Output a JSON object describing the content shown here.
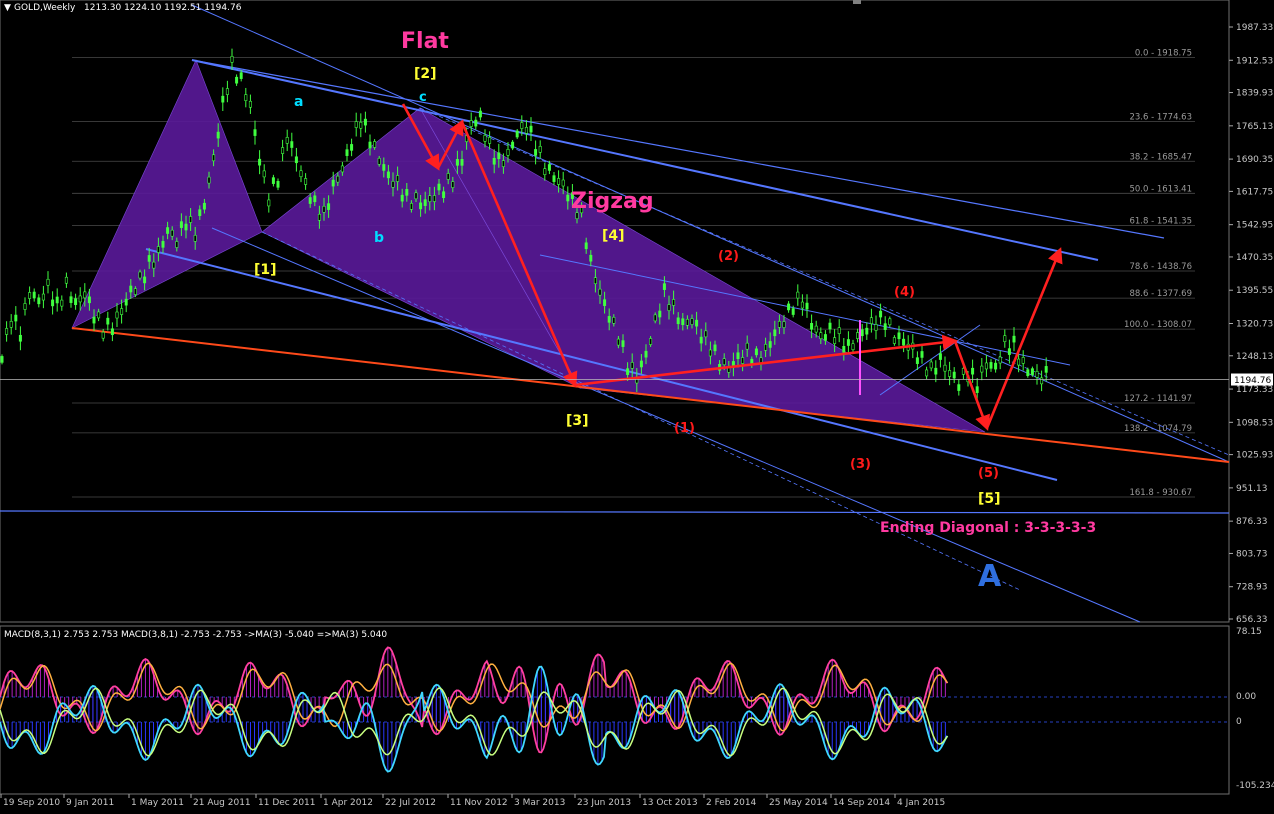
{
  "header": {
    "symbol": "GOLD,Weekly",
    "ohlc": "1213.30 1224.10 1192.51 1194.76"
  },
  "macd": {
    "label": "MACD(8,3,1) 2.753 2.753  MACD(3,8,1) -2.753 -2.753  ->MA(3) -5.040  =>MA(3) 5.040",
    "ticks": [
      "78.15",
      "0.00",
      "0",
      "-105.234"
    ]
  },
  "colors": {
    "bg": "#000000",
    "candle": "#40ff40",
    "triangle": "#5a1a9a",
    "channel": "#5577ff",
    "orange": "#ff4a1a",
    "red": "#ff1a1a",
    "cyan": "#00ddff",
    "yellow": "#ffff33",
    "magenta": "#ff3aa0",
    "wave": "#ff2020",
    "blueA": "#2f6fdf"
  },
  "chart_data": {
    "type": "line",
    "title": "GOLD,Weekly",
    "y_price_ticks": [
      "1987.33",
      "1912.53",
      "1839.93",
      "1765.13",
      "1690.35",
      "1617.75",
      "1542.95",
      "1470.35",
      "1395.55",
      "1320.73",
      "1248.13",
      "1173.33",
      "1098.53",
      "1025.93",
      "951.13",
      "876.33",
      "803.73",
      "728.93",
      "656.33"
    ],
    "ylim": [
      640,
      2010
    ],
    "current_price": "1194.76",
    "x_ticks": [
      "19 Sep 2010",
      "9 Jan 2011",
      "1 May 2011",
      "21 Aug 2011",
      "11 Dec 2011",
      "1 Apr 2012",
      "22 Jul 2012",
      "11 Nov 2012",
      "3 Mar 2013",
      "23 Jun 2013",
      "13 Oct 2013",
      "2 Feb 2014",
      "25 May 2014",
      "14 Sep 2014",
      "4 Jan 2015"
    ],
    "fib_levels": [
      {
        "label": "0.0 - 1918.75",
        "price": 1918.75
      },
      {
        "label": "23.6 - 1774.63",
        "price": 1774.63
      },
      {
        "label": "38.2 - 1685.47",
        "price": 1685.47
      },
      {
        "label": "50.0 - 1613.41",
        "price": 1613.41
      },
      {
        "label": "61.8 - 1541.35",
        "price": 1541.35
      },
      {
        "label": "78.6 - 1438.76",
        "price": 1438.76
      },
      {
        "label": "88.6 - 1377.69",
        "price": 1377.69
      },
      {
        "label": "100.0 - 1308.07",
        "price": 1308.07
      },
      {
        "label": "127.2 - 1141.97",
        "price": 1141.97
      },
      {
        "label": "138.2 - 1074.79",
        "price": 1074.79
      },
      {
        "label": "161.8 - 930.67",
        "price": 930.67
      }
    ],
    "price_path": [
      [
        0,
        1240
      ],
      [
        4,
        1330
      ],
      [
        8,
        1305
      ],
      [
        12,
        1400
      ],
      [
        16,
        1380
      ],
      [
        20,
        1410
      ],
      [
        24,
        1360
      ],
      [
        28,
        1400
      ],
      [
        32,
        1355
      ],
      [
        36,
        1380
      ],
      [
        40,
        1335
      ],
      [
        44,
        1310
      ],
      [
        48,
        1320
      ],
      [
        52,
        1360
      ],
      [
        56,
        1400
      ],
      [
        60,
        1420
      ],
      [
        64,
        1450
      ],
      [
        68,
        1470
      ],
      [
        72,
        1520
      ],
      [
        76,
        1500
      ],
      [
        80,
        1550
      ],
      [
        84,
        1530
      ],
      [
        88,
        1600
      ],
      [
        92,
        1700
      ],
      [
        96,
        1820
      ],
      [
        100,
        1900
      ],
      [
        104,
        1860
      ],
      [
        108,
        1800
      ],
      [
        112,
        1680
      ],
      [
        116,
        1600
      ],
      [
        120,
        1650
      ],
      [
        124,
        1750
      ],
      [
        128,
        1700
      ],
      [
        132,
        1640
      ],
      [
        136,
        1590
      ],
      [
        140,
        1560
      ],
      [
        144,
        1620
      ],
      [
        148,
        1660
      ],
      [
        152,
        1720
      ],
      [
        156,
        1780
      ],
      [
        160,
        1740
      ],
      [
        164,
        1700
      ],
      [
        168,
        1660
      ],
      [
        172,
        1640
      ],
      [
        176,
        1600
      ],
      [
        180,
        1590
      ],
      [
        184,
        1580
      ],
      [
        188,
        1600
      ],
      [
        192,
        1620
      ],
      [
        196,
        1650
      ],
      [
        200,
        1700
      ],
      [
        204,
        1780
      ],
      [
        208,
        1790
      ],
      [
        212,
        1720
      ],
      [
        216,
        1680
      ],
      [
        220,
        1690
      ],
      [
        224,
        1740
      ],
      [
        228,
        1760
      ],
      [
        232,
        1720
      ],
      [
        236,
        1680
      ],
      [
        240,
        1660
      ],
      [
        244,
        1640
      ],
      [
        248,
        1600
      ],
      [
        252,
        1560
      ],
      [
        256,
        1450
      ],
      [
        260,
        1380
      ],
      [
        264,
        1330
      ],
      [
        268,
        1290
      ],
      [
        272,
        1230
      ],
      [
        276,
        1210
      ],
      [
        280,
        1260
      ],
      [
        284,
        1330
      ],
      [
        288,
        1390
      ],
      [
        292,
        1350
      ],
      [
        296,
        1310
      ],
      [
        300,
        1320
      ],
      [
        304,
        1290
      ],
      [
        308,
        1270
      ],
      [
        312,
        1240
      ],
      [
        316,
        1230
      ],
      [
        320,
        1250
      ],
      [
        324,
        1260
      ],
      [
        328,
        1240
      ],
      [
        332,
        1250
      ],
      [
        336,
        1290
      ],
      [
        340,
        1320
      ],
      [
        344,
        1360
      ],
      [
        348,
        1380
      ],
      [
        352,
        1330
      ],
      [
        356,
        1300
      ],
      [
        360,
        1310
      ],
      [
        364,
        1290
      ],
      [
        368,
        1260
      ],
      [
        372,
        1280
      ],
      [
        376,
        1300
      ],
      [
        380,
        1320
      ],
      [
        384,
        1330
      ],
      [
        388,
        1300
      ],
      [
        392,
        1290
      ],
      [
        396,
        1270
      ],
      [
        400,
        1240
      ],
      [
        404,
        1210
      ],
      [
        408,
        1230
      ],
      [
        412,
        1200
      ],
      [
        416,
        1180
      ],
      [
        420,
        1210
      ],
      [
        424,
        1190
      ],
      [
        428,
        1240
      ],
      [
        432,
        1230
      ],
      [
        436,
        1280
      ],
      [
        440,
        1270
      ],
      [
        444,
        1220
      ],
      [
        448,
        1200
      ],
      [
        452,
        1190
      ],
      [
        456,
        1210
      ]
    ],
    "wave_labels": [
      {
        "text": "Flat",
        "color": "magenta"
      },
      {
        "text": "[2]",
        "color": "yellow"
      },
      {
        "text": "c",
        "color": "cyan"
      },
      {
        "text": "a",
        "color": "cyan"
      },
      {
        "text": "b",
        "color": "cyan"
      },
      {
        "text": "[1]",
        "color": "yellow"
      },
      {
        "text": "Zigzag",
        "color": "magenta"
      },
      {
        "text": "[4]",
        "color": "yellow"
      },
      {
        "text": "[3]",
        "color": "yellow"
      },
      {
        "text": "[5]",
        "color": "yellow"
      },
      {
        "text": "A",
        "color": "blueA"
      },
      {
        "text": "Ending Diagonal : 3-3-3-3-3",
        "color": "magenta"
      },
      {
        "text": "(1)",
        "color": "red"
      },
      {
        "text": "(2)",
        "color": "red"
      },
      {
        "text": "(3)",
        "color": "red"
      },
      {
        "text": "(4)",
        "color": "red"
      },
      {
        "text": "(5)",
        "color": "red"
      }
    ]
  }
}
